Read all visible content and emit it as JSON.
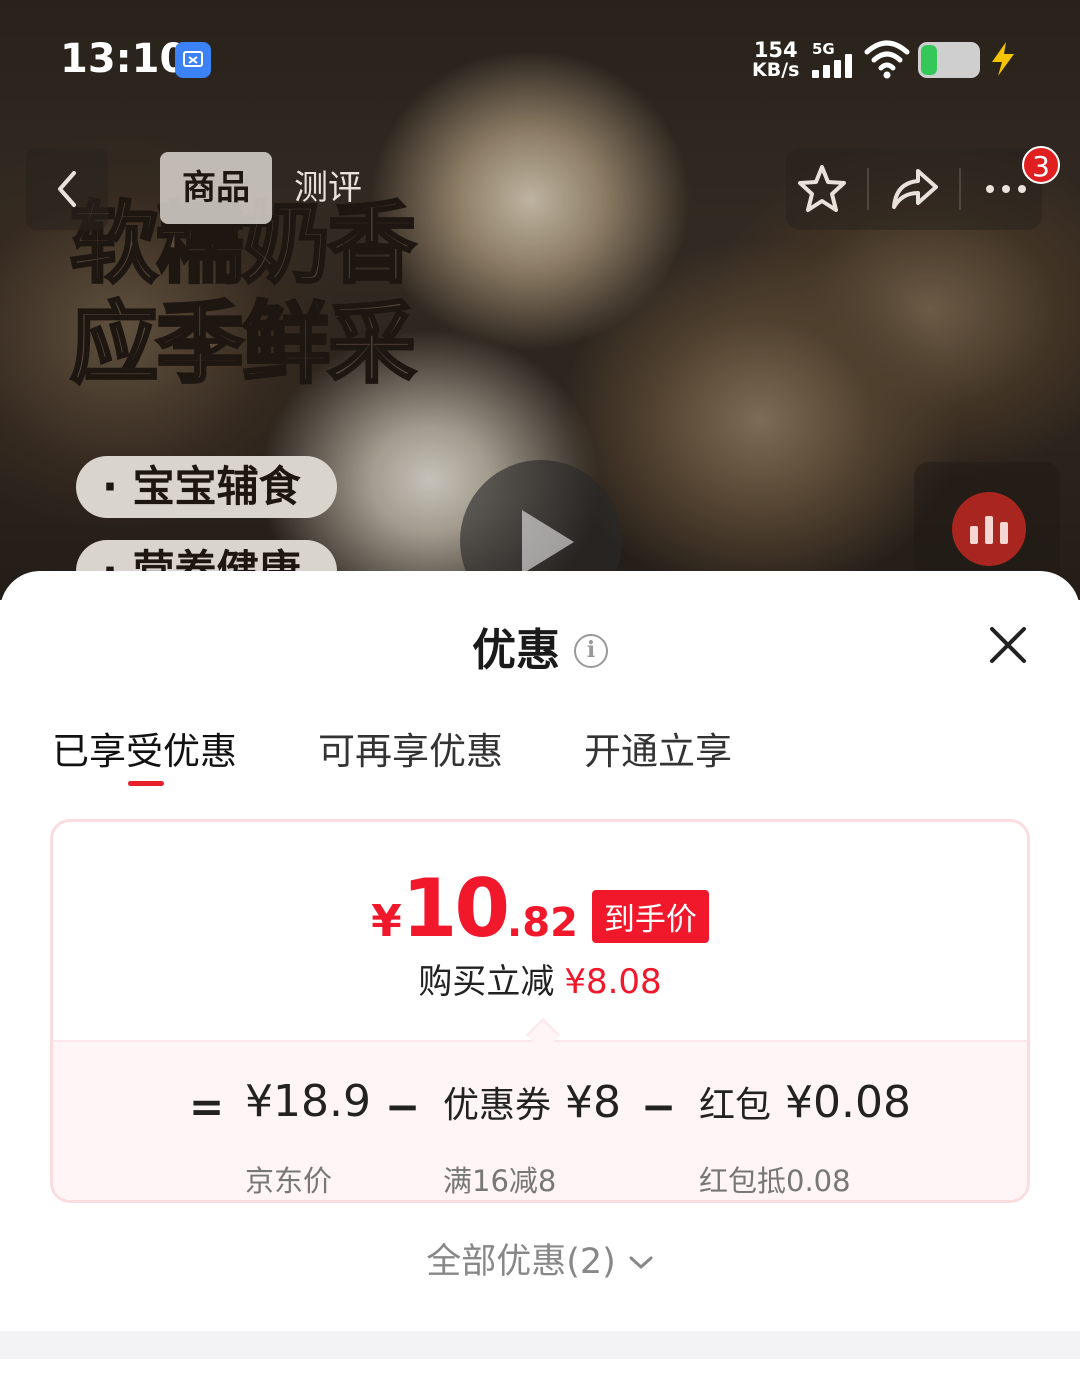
{
  "status_bar": {
    "time": "13:10",
    "net_speed_value": "154",
    "net_speed_unit": "KB/s",
    "network": "5G",
    "icons": [
      "screenshot-app-icon",
      "signal-icon",
      "wifi-icon",
      "battery-icon",
      "charging-bolt-icon"
    ]
  },
  "nav": {
    "tabs": [
      "商品",
      "测评"
    ],
    "active_tab": "商品",
    "cart_badge": "3",
    "icons": [
      "back-icon",
      "star-icon",
      "share-icon",
      "more-icon"
    ]
  },
  "hero": {
    "headline_1": "软糯奶香",
    "headline_2": "应季鲜采",
    "tag_1": "· 宝宝辅食",
    "tag_2": "· 营养健康"
  },
  "sheet": {
    "title": "优惠",
    "tabs": [
      "已享受优惠",
      "可再享优惠",
      "开通立享"
    ],
    "active_tab": "已享受优惠",
    "price": {
      "currency": "¥",
      "integer": "10",
      "decimal": ".82",
      "tag": "到手价"
    },
    "saving": {
      "label": "购买立减",
      "amount": "¥8.08"
    },
    "breakdown": {
      "eq": "=",
      "minus": "−",
      "jd_price": "¥18.9",
      "jd_price_label": "京东价",
      "coupon_label": "优惠券",
      "coupon_value": "¥8",
      "coupon_rule": "满16减8",
      "redpacket_label": "红包",
      "redpacket_value": "¥0.08",
      "redpacket_rule": "红包抵0.08"
    },
    "all_offers": "全部优惠(2)"
  },
  "colors": {
    "accent_red": "#f0182a",
    "card_border": "#fbdde0",
    "breakdown_bg": "#fff5f6"
  }
}
